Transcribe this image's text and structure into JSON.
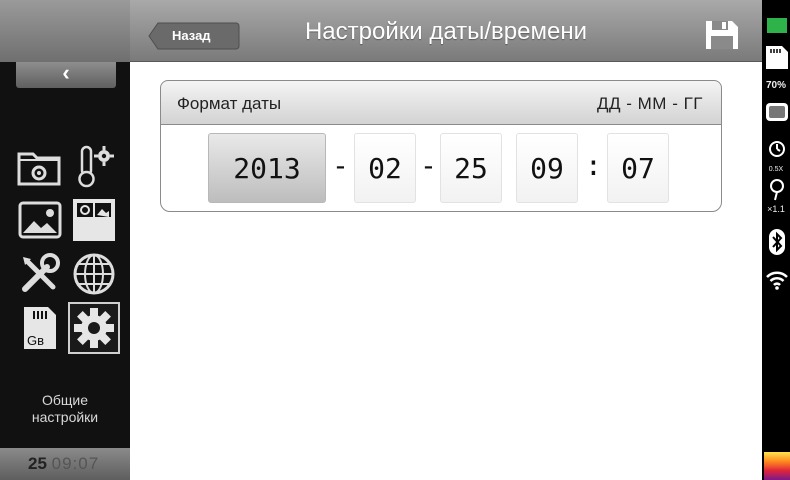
{
  "header": {
    "back_label": "Назад",
    "title": "Настройки даты/времени",
    "save_icon": "save-icon"
  },
  "sidebar": {
    "collapse_glyph": "‹",
    "tiles": [
      {
        "name": "folder-settings",
        "icon": "folder-gear-icon"
      },
      {
        "name": "temperature-settings",
        "icon": "thermometer-gear-icon"
      },
      {
        "name": "image-settings",
        "icon": "image-icon"
      },
      {
        "name": "picture-in-picture",
        "icon": "pip-icon"
      },
      {
        "name": "tools",
        "icon": "tools-icon"
      },
      {
        "name": "language",
        "icon": "globe-icon"
      },
      {
        "name": "storage",
        "icon": "sd-card-icon",
        "label": "Gв"
      },
      {
        "name": "general-settings",
        "icon": "gear-icon",
        "selected": true
      }
    ],
    "selected_label": "Общие\nнастройки",
    "clock_day": "25",
    "clock_time": "09:07"
  },
  "format": {
    "label": "Формат даты",
    "value": "ДД - ММ - ГГ"
  },
  "datetime": {
    "year": "2013",
    "month": "02",
    "day": "25",
    "hour": "09",
    "minute": "07",
    "date_separator": "-",
    "time_separator": ":"
  },
  "status": {
    "battery_percent": "70%",
    "speed_label": "0.5X",
    "zoom_label": "×1.1"
  },
  "colors": {
    "accent": "#8a8a8a",
    "selected_field": "#c8c8c8",
    "header": "#8f8f8f"
  }
}
